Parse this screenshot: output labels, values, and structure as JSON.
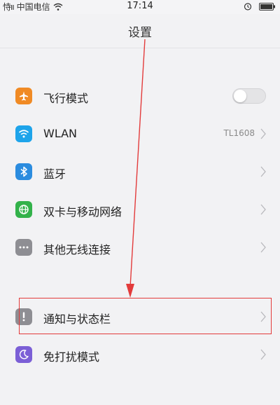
{
  "status_bar": {
    "signal": "恃ıı",
    "carrier": "中国电信",
    "time": "17:14"
  },
  "header": {
    "title": "设置"
  },
  "settings": {
    "airplane": {
      "label": "飞行模式",
      "icon": "airplane-icon",
      "color": "#f08a24",
      "enabled": false
    },
    "wlan": {
      "label": "WLAN",
      "value": "TL1608",
      "icon": "wifi-icon",
      "color": "#1ea4ea"
    },
    "bluetooth": {
      "label": "蓝牙",
      "icon": "bluetooth-icon",
      "color": "#2b8cdf"
    },
    "dual_sim": {
      "label": "双卡与移动网络",
      "icon": "globe-icon",
      "color": "#33b24a"
    },
    "other_wireless": {
      "label": "其他无线连接",
      "icon": "more-dots-icon",
      "color": "#8e8e93"
    },
    "notifications": {
      "label": "通知与状态栏",
      "icon": "exclamation-icon",
      "color": "#8e8e93"
    },
    "dnd": {
      "label": "免打扰模式",
      "icon": "moon-icon",
      "color": "#7b5fd6"
    }
  },
  "annotation_color": "#e33b3b"
}
